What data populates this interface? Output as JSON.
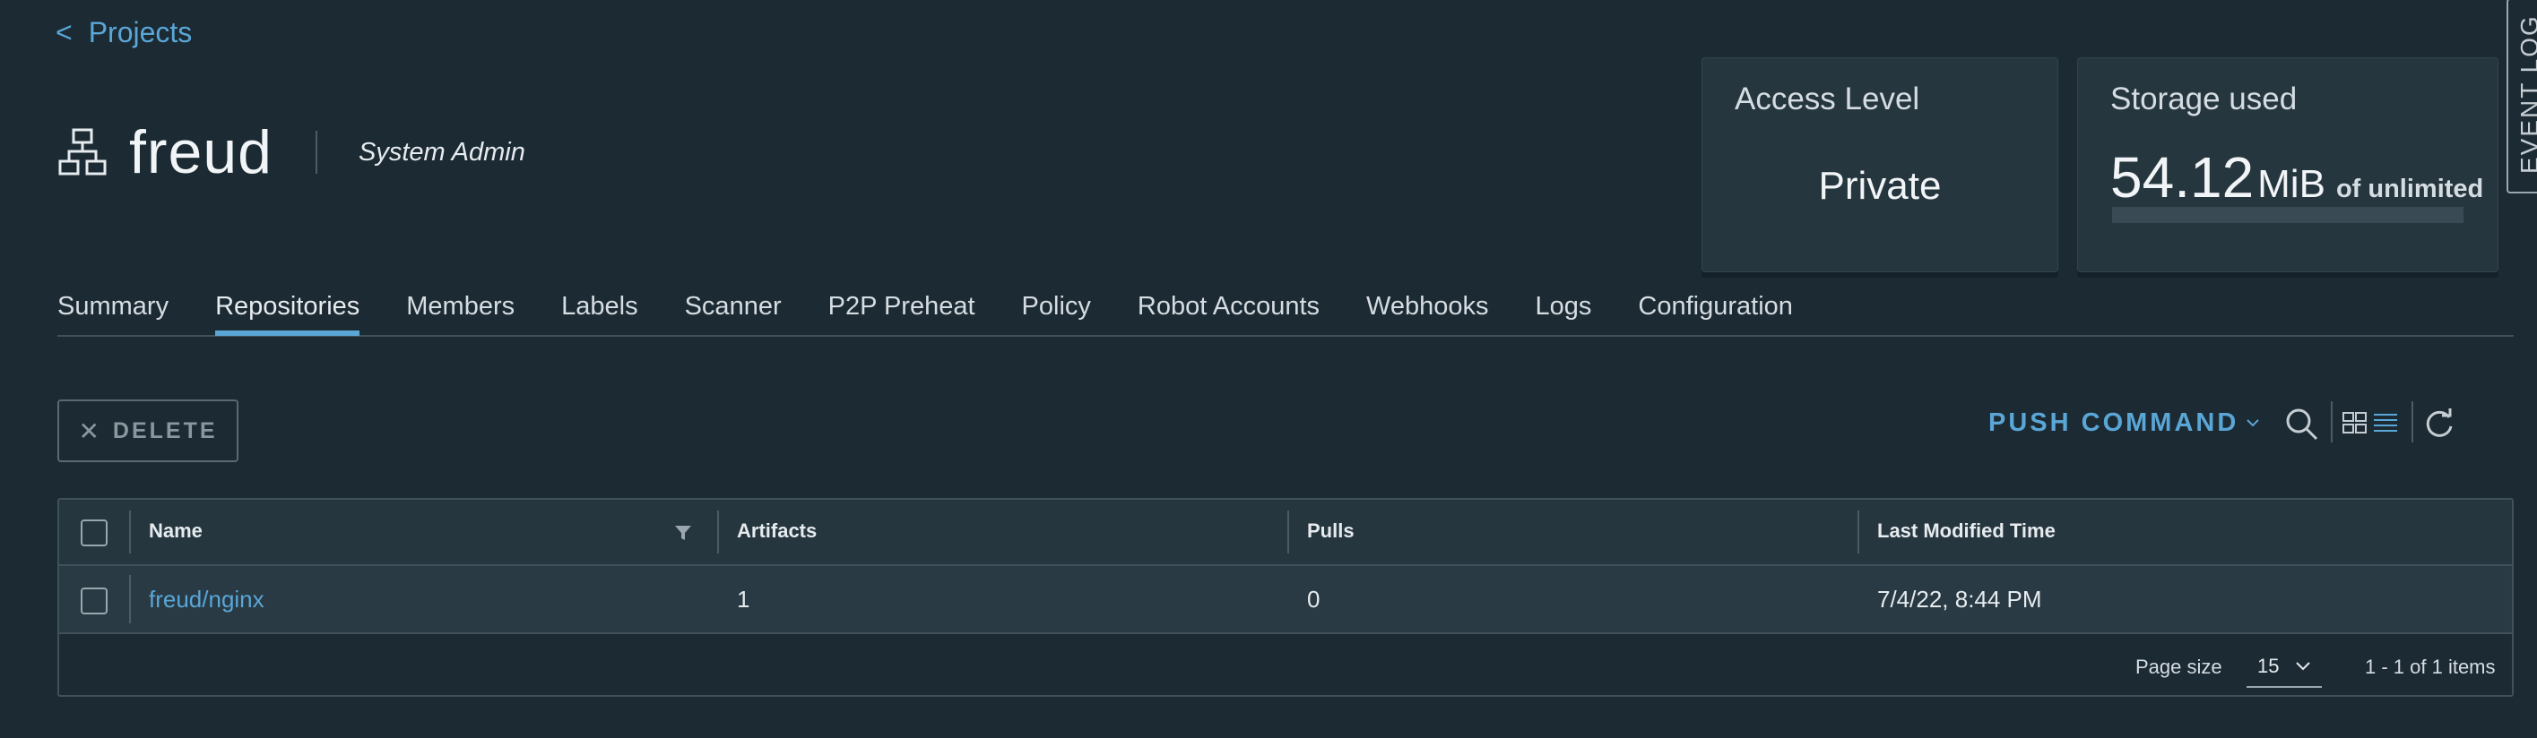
{
  "breadcrumb": {
    "caret": "<",
    "label": "Projects"
  },
  "project": {
    "name": "freud",
    "role": "System Admin"
  },
  "cards": {
    "access": {
      "title": "Access Level",
      "value": "Private"
    },
    "storage": {
      "title": "Storage used",
      "amount": "54.12",
      "unit": "MiB",
      "of_label": "of unlimited",
      "usage_fraction": 0
    }
  },
  "event_log": {
    "label": "EVENT LOG"
  },
  "tabs": [
    {
      "label": "Summary"
    },
    {
      "label": "Repositories"
    },
    {
      "label": "Members"
    },
    {
      "label": "Labels"
    },
    {
      "label": "Scanner"
    },
    {
      "label": "P2P Preheat"
    },
    {
      "label": "Policy"
    },
    {
      "label": "Robot Accounts"
    },
    {
      "label": "Webhooks"
    },
    {
      "label": "Logs"
    },
    {
      "label": "Configuration"
    }
  ],
  "active_tab": "Repositories",
  "toolbar": {
    "delete_label": "DELETE",
    "push_command_label": "PUSH COMMAND"
  },
  "table": {
    "headers": {
      "name": "Name",
      "artifacts": "Artifacts",
      "pulls": "Pulls",
      "last_modified": "Last Modified Time"
    },
    "rows": [
      {
        "name": "freud/nginx",
        "artifacts": "1",
        "pulls": "0",
        "last_modified": "7/4/22, 8:44 PM"
      }
    ],
    "footer": {
      "page_size_label": "Page size",
      "page_size_value": "15",
      "items_count": "1 - 1 of 1 items"
    }
  },
  "colors": {
    "accent": "#5aa6d6",
    "background": "#1c2a33",
    "card": "#26363f"
  }
}
